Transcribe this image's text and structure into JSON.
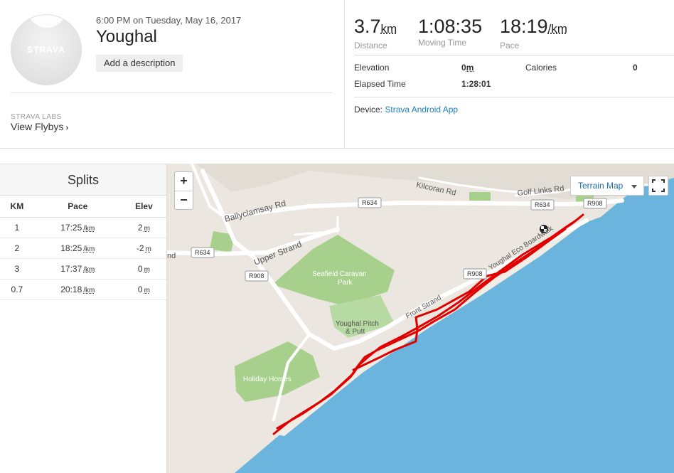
{
  "activity": {
    "datetime": "6:00 PM on Tuesday, May 16, 2017",
    "title": "Youghal",
    "add_description": "Add a description",
    "avatar_logo": "STRAVA"
  },
  "labs": {
    "kicker": "STRAVA LABS",
    "link": "View Flybys"
  },
  "stats": {
    "distance": {
      "value": "3.7",
      "unit": "km",
      "label": "Distance"
    },
    "moving_time": {
      "value": "1:08:35",
      "label": "Moving Time"
    },
    "pace": {
      "value": "18:19",
      "unit": "/km",
      "label": "Pace"
    },
    "elevation": {
      "label": "Elevation",
      "value": "0",
      "unit": "m"
    },
    "calories": {
      "label": "Calories",
      "value": "0"
    },
    "elapsed": {
      "label": "Elapsed Time",
      "value": "1:28:01"
    },
    "device": {
      "label": "Device:",
      "value": "Strava Android App"
    }
  },
  "splits": {
    "title": "Splits",
    "headers": [
      "KM",
      "Pace",
      "Elev"
    ],
    "rows": [
      {
        "km": "1",
        "pace": "17:25",
        "pace_unit": "/km",
        "elev": "2",
        "elev_unit": "m"
      },
      {
        "km": "2",
        "pace": "18:25",
        "pace_unit": "/km",
        "elev": "-2",
        "elev_unit": "m"
      },
      {
        "km": "3",
        "pace": "17:37",
        "pace_unit": "/km",
        "elev": "0",
        "elev_unit": "m"
      },
      {
        "km": "0.7",
        "pace": "20:18",
        "pace_unit": "/km",
        "elev": "0",
        "elev_unit": "m"
      }
    ]
  },
  "map": {
    "zoom_in": "+",
    "zoom_out": "−",
    "layer_select": "Terrain Map",
    "labels": {
      "kilcoran": "Kilcoran Rd",
      "golf_links": "Golf Links Rd",
      "ballyclamsay": "Ballyclamsay Rd",
      "upper_strand": "Upper Strand",
      "seafield": "Seafield Caravan",
      "park": "Park",
      "pitch_putt_1": "Youghal Pitch",
      "pitch_putt_2": "& Putt",
      "holiday_homes": "Holiday Homes",
      "eco_boardwalk": "Youghal Eco Boardwalk",
      "front_strand": "Front Strand",
      "partial_nd": "nd"
    },
    "road_shields": {
      "r634_a": "R634",
      "r634_b": "R634",
      "r634_c": "R634",
      "r908_a": "R908",
      "r908_b": "R908",
      "r908_c": "R908"
    },
    "colors": {
      "sea": "#6ab4de",
      "land": "#ebe6df",
      "park": "#a8d08d",
      "route": "#e00000",
      "link": "#1e7fbf"
    }
  }
}
